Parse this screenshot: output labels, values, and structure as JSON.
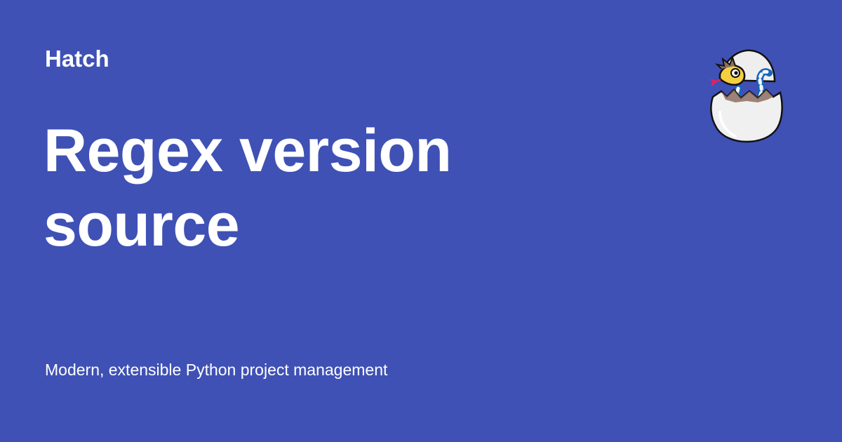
{
  "site": {
    "name": "Hatch",
    "logo_icon": "hatching-egg-snake-logo-icon"
  },
  "page": {
    "title": "Regex version source",
    "description": "Modern, extensible Python project management"
  },
  "colors": {
    "background": "#3f51b5",
    "text": "#ffffff"
  }
}
